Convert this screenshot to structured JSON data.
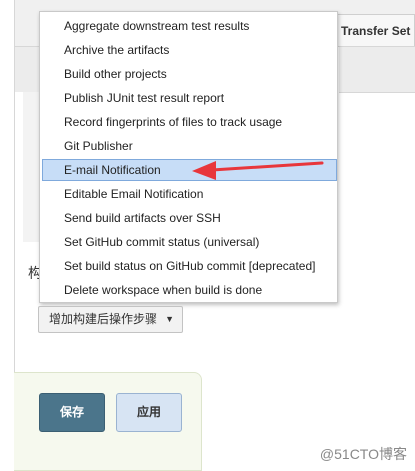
{
  "menu": {
    "items": [
      {
        "label": "Aggregate downstream test results",
        "selected": false
      },
      {
        "label": "Archive the artifacts",
        "selected": false
      },
      {
        "label": "Build other projects",
        "selected": false
      },
      {
        "label": "Publish JUnit test result report",
        "selected": false
      },
      {
        "label": "Record fingerprints of files to track usage",
        "selected": false
      },
      {
        "label": "Git Publisher",
        "selected": false
      },
      {
        "label": "E-mail Notification",
        "selected": true
      },
      {
        "label": "Editable Email Notification",
        "selected": false
      },
      {
        "label": "Send build artifacts over SSH",
        "selected": false
      },
      {
        "label": "Set GitHub commit status (universal)",
        "selected": false
      },
      {
        "label": "Set build status on GitHub commit [deprecated]",
        "selected": false
      },
      {
        "label": "Delete workspace when build is done",
        "selected": false
      }
    ]
  },
  "background": {
    "tab_transfer_label": "Transfer Set",
    "section_fragment": "构"
  },
  "add_step_button": {
    "label": "增加构建后操作步骤"
  },
  "actions": {
    "save_label": "保存",
    "apply_label": "应用"
  },
  "watermark": "@51CTO博客",
  "colors": {
    "selection": "#c7ddf7",
    "save_button": "#4b758b",
    "annotation_arrow": "#e8363b"
  }
}
